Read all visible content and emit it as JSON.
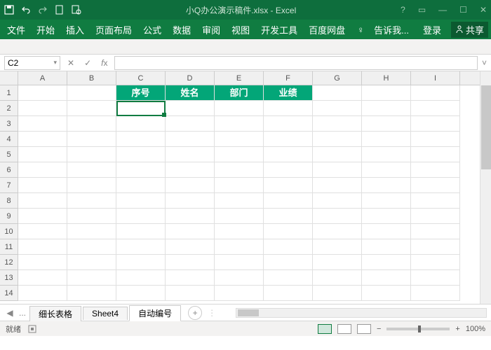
{
  "title": "小Q办公演示稿件.xlsx - Excel",
  "ribbon": {
    "tabs": [
      "文件",
      "开始",
      "插入",
      "页面布局",
      "公式",
      "数据",
      "审阅",
      "视图",
      "开发工具",
      "百度网盘"
    ],
    "tell_me": "告诉我...",
    "login": "登录",
    "share": "共享"
  },
  "namebox": "C2",
  "columns": [
    "A",
    "B",
    "C",
    "D",
    "E",
    "F",
    "G",
    "H",
    "I"
  ],
  "rows": [
    "1",
    "2",
    "3",
    "4",
    "5",
    "6",
    "7",
    "8",
    "9",
    "10",
    "11",
    "12",
    "13",
    "14"
  ],
  "headers": {
    "C1": "序号",
    "D1": "姓名",
    "E1": "部门",
    "F1": "业绩"
  },
  "selected_cell": "C2",
  "sheets": {
    "items": [
      "细长表格",
      "Sheet4",
      "自动编号"
    ],
    "active": "自动编号",
    "ellipsis": "..."
  },
  "status": {
    "ready": "就绪",
    "zoom": "100%"
  },
  "accent": "#107c41",
  "header_fill": "#03a678"
}
